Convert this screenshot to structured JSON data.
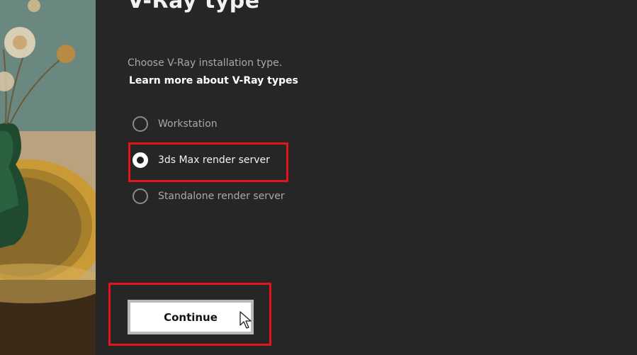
{
  "page": {
    "heading": "V-Ray type",
    "subtitle": "Choose V-Ray installation type.",
    "learn_more_link": "Learn more about V-Ray types"
  },
  "install_types": [
    {
      "label": "Workstation",
      "selected": false
    },
    {
      "label": "3ds Max render server",
      "selected": true
    },
    {
      "label": "Standalone render server",
      "selected": false
    }
  ],
  "actions": {
    "continue_label": "Continue"
  },
  "colors": {
    "background": "#262626",
    "highlight": "#e3141b",
    "text_primary": "#f2f2f2",
    "text_secondary": "#a9a9a9"
  },
  "icons": {
    "cursor": "arrow-cursor-icon",
    "radio": "radio-button-icon"
  }
}
